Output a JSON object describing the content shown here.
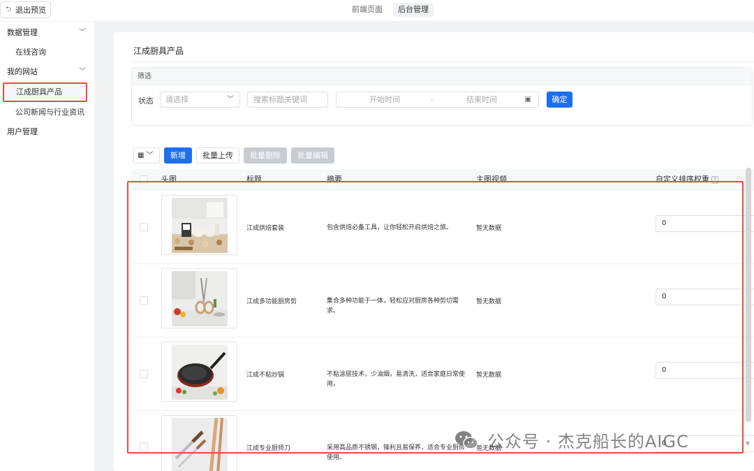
{
  "topbar": {
    "exit_label": "退出预览",
    "tabs": [
      {
        "label": "前端页面",
        "active": false
      },
      {
        "label": "后台管理",
        "active": true
      }
    ]
  },
  "sidebar": {
    "groups": [
      {
        "label": "数据管理",
        "items": [
          {
            "label": "在线咨询",
            "selected": false
          }
        ]
      },
      {
        "label": "我的网站",
        "items": [
          {
            "label": "江成厨具产品",
            "selected": true
          },
          {
            "label": "公司新闻与行业资讯",
            "selected": false
          }
        ]
      },
      {
        "label": "用户管理",
        "items": []
      }
    ]
  },
  "page": {
    "title": "江成厨具产品"
  },
  "filter": {
    "heading": "筛选",
    "status_label": "状态",
    "status_placeholder": "请选择",
    "search_placeholder": "搜索标题关键词",
    "start_placeholder": "开始时间",
    "range_sep": "-",
    "end_placeholder": "结束时间",
    "confirm_label": "确定"
  },
  "toolbar": {
    "add_label": "新增",
    "batch_upload_label": "批量上传",
    "batch_delete_label": "批量删除",
    "batch_edit_label": "批量编辑"
  },
  "table": {
    "columns": [
      "头图",
      "标题",
      "摘要",
      "主图视频",
      "自定义排序权重"
    ],
    "help_mark": "?",
    "rows": [
      {
        "title": "江成烘焙套装",
        "summary": "包含烘焙必备工具，让你轻松开启烘焙之旅。",
        "video": "暂无数据",
        "weight": "0",
        "image": "baking-set"
      },
      {
        "title": "江成多功能厨房剪",
        "summary": "集合多种功能于一体，轻松应对厨房各种剪切需求。",
        "video": "暂无数据",
        "weight": "0",
        "image": "kitchen-scissors"
      },
      {
        "title": "江成不粘炒锅",
        "summary": "不粘涂层技术，少油烟，易清洗，适合家庭日常使用。",
        "video": "暂无数据",
        "weight": "0",
        "image": "nonstick-wok"
      },
      {
        "title": "江成专业厨师刀",
        "summary": "采用高品质不锈钢，锋利且易保养，适合专业厨房使用。",
        "video": "暂无数据",
        "weight": "0",
        "image": "chef-knife"
      }
    ]
  },
  "watermark": {
    "text": "公众号 · 杰克船长的AIGC"
  },
  "colors": {
    "primary": "#1e6ff0",
    "highlight": "#e74c3c",
    "disabled": "#c8cbd0"
  }
}
